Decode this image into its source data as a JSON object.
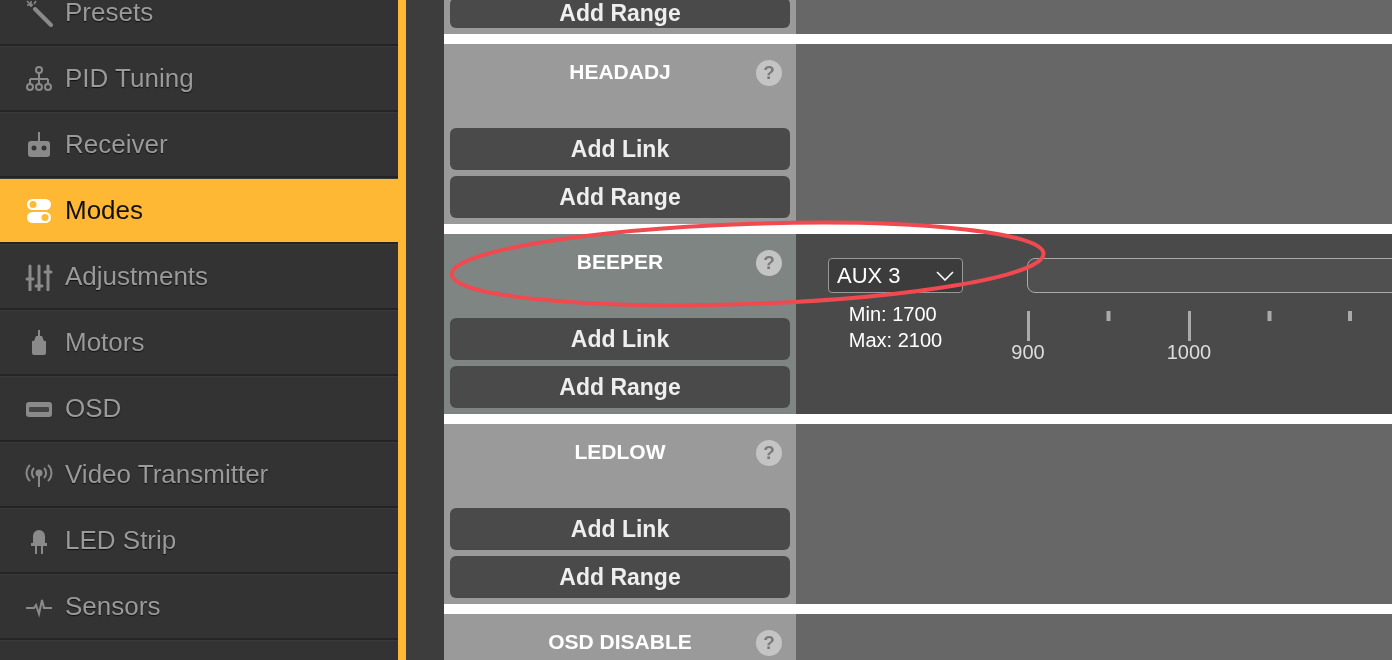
{
  "sidebar": {
    "items": [
      {
        "label": "Presets",
        "selected": false
      },
      {
        "label": "PID Tuning",
        "selected": false
      },
      {
        "label": "Receiver",
        "selected": false
      },
      {
        "label": "Modes",
        "selected": true
      },
      {
        "label": "Adjustments",
        "selected": false
      },
      {
        "label": "Motors",
        "selected": false
      },
      {
        "label": "OSD",
        "selected": false
      },
      {
        "label": "Video Transmitter",
        "selected": false
      },
      {
        "label": "LED Strip",
        "selected": false
      },
      {
        "label": "Sensors",
        "selected": false
      }
    ]
  },
  "modes": [
    {
      "buttons": [
        "Add Range"
      ],
      "active": false
    },
    {
      "name": "HEADADJ",
      "help": "?",
      "buttons": [
        "Add Link",
        "Add Range"
      ],
      "active": false
    },
    {
      "name": "BEEPER",
      "help": "?",
      "buttons": [
        "Add Link",
        "Add Range"
      ],
      "active": true,
      "range": {
        "channel": "AUX 3",
        "min": "Min: 1700",
        "max": "Max: 2100",
        "scale_labels": [
          "900",
          "1000"
        ]
      }
    },
    {
      "name": "LEDLOW",
      "help": "?",
      "buttons": [
        "Add Link",
        "Add Range"
      ],
      "active": false
    },
    {
      "name": "OSD DISABLE",
      "help": "?",
      "active": false
    }
  ],
  "annotation": {
    "kind": "ellipse",
    "color": "#f04a50"
  }
}
